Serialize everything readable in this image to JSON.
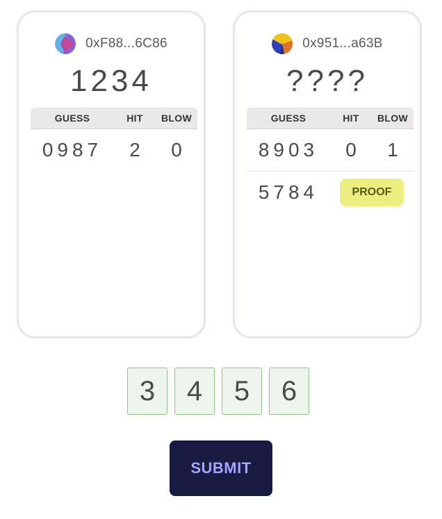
{
  "players": [
    {
      "address": "0xF88...6C86",
      "secret": "1234",
      "avatar_colors": [
        "#5fb3e8",
        "#c0479a",
        "#8a63d2"
      ],
      "columns": [
        "GUESS",
        "HIT",
        "BLOW"
      ],
      "rows": [
        {
          "guess": "0987",
          "hit": "2",
          "blow": "0"
        }
      ]
    },
    {
      "address": "0x951...a63B",
      "secret": "????",
      "avatar_colors": [
        "#f2c21b",
        "#2d3fb8",
        "#e0702a"
      ],
      "columns": [
        "GUESS",
        "HIT",
        "BLOW"
      ],
      "rows": [
        {
          "guess": "8903",
          "hit": "0",
          "blow": "1"
        },
        {
          "guess": "5784",
          "action": "PROOF"
        }
      ]
    }
  ],
  "input_digits": [
    "3",
    "4",
    "5",
    "6"
  ],
  "submit_label": "SUBMIT",
  "colors": {
    "proof_button": "#ecef7f",
    "digit_box_border": "#8ec28a",
    "digit_box_bg": "#eef5ec",
    "submit_bg": "#181a40",
    "submit_text": "#a3a6ff",
    "card_border": "#e2e6ef"
  }
}
